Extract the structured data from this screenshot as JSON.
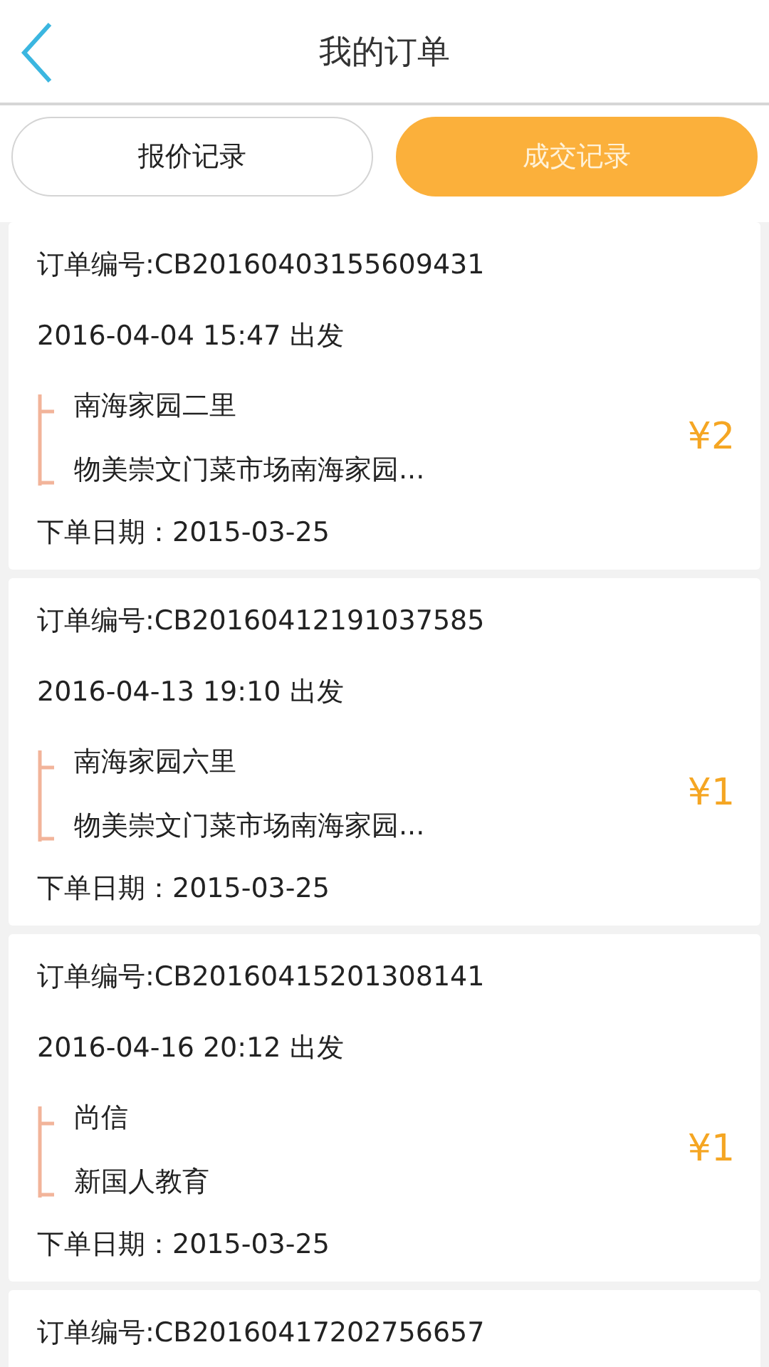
{
  "header": {
    "title": "我的订单"
  },
  "tabs": [
    {
      "label": "报价记录",
      "selected": false
    },
    {
      "label": "成交记录",
      "selected": true
    }
  ],
  "orders": [
    {
      "order_no": "订单编号:CB20160403155609431",
      "departure": "2016-04-04 15:47 出发",
      "from": "南海家园二里",
      "to": "物美崇文门菜市场南海家园...",
      "price": "¥2",
      "order_date": "下单日期：2015-03-25"
    },
    {
      "order_no": "订单编号:CB20160412191037585",
      "departure": "2016-04-13 19:10 出发",
      "from": "南海家园六里",
      "to": "物美崇文门菜市场南海家园...",
      "price": "¥1",
      "order_date": "下单日期：2015-03-25"
    },
    {
      "order_no": "订单编号:CB20160415201308141",
      "departure": "2016-04-16 20:12 出发",
      "from": "尚信",
      "to": "新国人教育",
      "price": "¥1",
      "order_date": "下单日期：2015-03-25"
    },
    {
      "order_no": "订单编号:CB20160417202756657"
    }
  ]
}
